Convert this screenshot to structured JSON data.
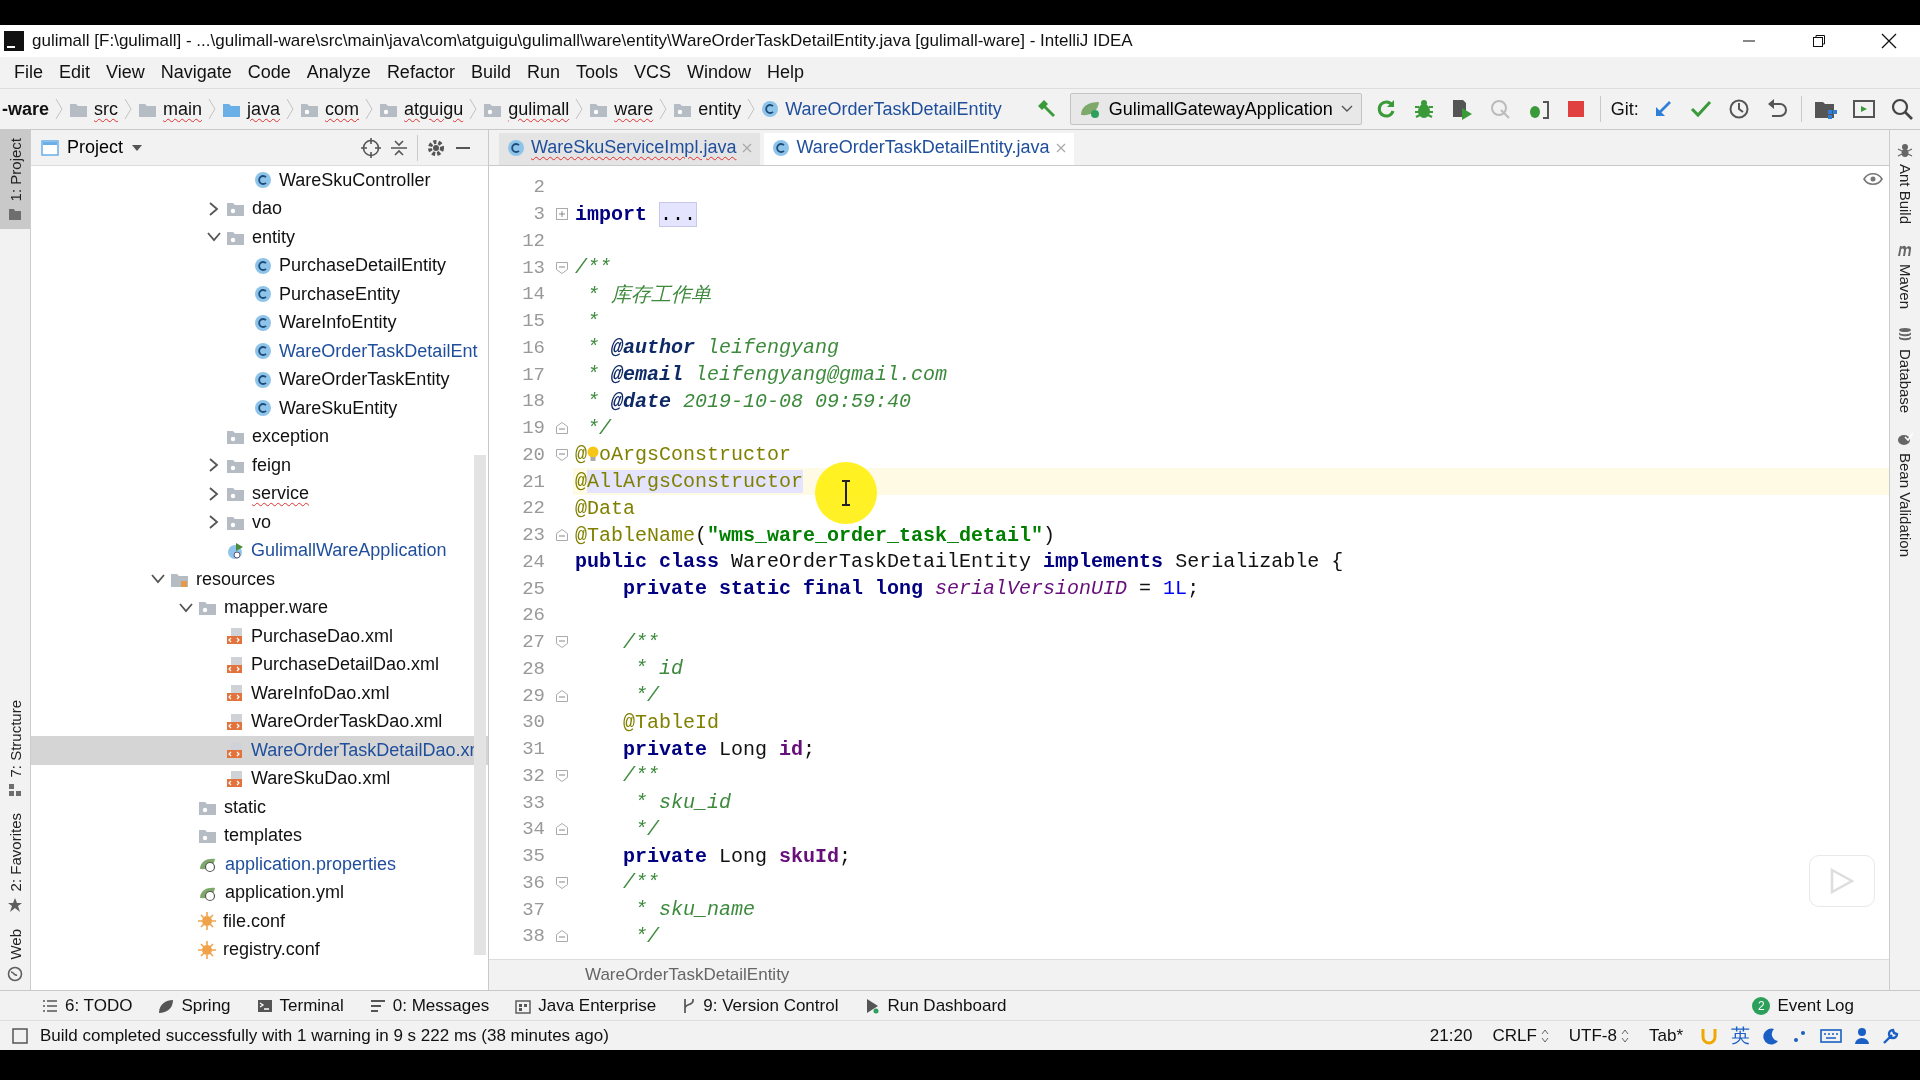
{
  "window": {
    "title": "gulimall [F:\\gulimall] - ...\\gulimall-ware\\src\\main\\java\\com\\atguigu\\gulimall\\ware\\entity\\WareOrderTaskDetailEntity.java [gulimall-ware] - IntelliJ IDEA"
  },
  "menu": [
    "File",
    "Edit",
    "View",
    "Navigate",
    "Code",
    "Analyze",
    "Refactor",
    "Build",
    "Run",
    "Tools",
    "VCS",
    "Window",
    "Help"
  ],
  "breadcrumbs": [
    {
      "label": "-ware",
      "kind": "module",
      "error": false
    },
    {
      "label": "src",
      "kind": "folder",
      "error": true
    },
    {
      "label": "main",
      "kind": "folder",
      "error": true
    },
    {
      "label": "java",
      "kind": "source-folder",
      "error": true
    },
    {
      "label": "com",
      "kind": "package",
      "error": true
    },
    {
      "label": "atguigu",
      "kind": "package",
      "error": true
    },
    {
      "label": "gulimall",
      "kind": "package",
      "error": true
    },
    {
      "label": "ware",
      "kind": "package",
      "error": true
    },
    {
      "label": "entity",
      "kind": "package",
      "error": false
    },
    {
      "label": "WareOrderTaskDetailEntity",
      "kind": "class",
      "error": false
    }
  ],
  "run_config": {
    "label": "GulimallGatewayApplication"
  },
  "vcs_label": "Git:",
  "left_stripe": [
    {
      "label": "1: Project",
      "kind": "folder",
      "selected": true
    },
    {
      "label": "7: Structure",
      "kind": "structure",
      "selected": false
    },
    {
      "label": "2: Favorites",
      "kind": "star",
      "selected": false
    },
    {
      "label": "Web",
      "kind": "globe",
      "selected": false
    }
  ],
  "project_panel": {
    "title": "Project",
    "tree": [
      {
        "kind": "offscreen",
        "children": [
          {
            "kind": "offscreen",
            "children": [
              {
                "kind": "offscreen",
                "children": [
                  {
                    "label": "WareSkuController",
                    "kind": "class",
                    "selected": false,
                    "modified": false,
                    "error": false
                  }
                ]
              },
              {
                "label": "dao",
                "kind": "package",
                "expanded": false,
                "selected": false,
                "modified": false,
                "error": false
              },
              {
                "label": "entity",
                "kind": "package",
                "expanded": true,
                "selected": false,
                "modified": false,
                "error": false,
                "children": [
                  {
                    "label": "PurchaseDetailEntity",
                    "kind": "class",
                    "selected": false,
                    "modified": false,
                    "error": false
                  },
                  {
                    "label": "PurchaseEntity",
                    "kind": "class",
                    "selected": false,
                    "modified": false,
                    "error": false
                  },
                  {
                    "label": "WareInfoEntity",
                    "kind": "class",
                    "selected": false,
                    "modified": false,
                    "error": false
                  },
                  {
                    "label": "WareOrderTaskDetailEnt",
                    "kind": "class",
                    "selected": false,
                    "modified": true,
                    "error": false
                  },
                  {
                    "label": "WareOrderTaskEntity",
                    "kind": "class",
                    "selected": false,
                    "modified": false,
                    "error": false
                  },
                  {
                    "label": "WareSkuEntity",
                    "kind": "class",
                    "selected": false,
                    "modified": false,
                    "error": false
                  }
                ]
              },
              {
                "label": "exception",
                "kind": "package",
                "selected": false,
                "modified": false,
                "error": false
              },
              {
                "label": "feign",
                "kind": "package",
                "expanded": false,
                "selected": false,
                "modified": false,
                "error": false
              },
              {
                "label": "service",
                "kind": "package",
                "expanded": false,
                "selected": false,
                "modified": false,
                "error": true
              },
              {
                "label": "vo",
                "kind": "package",
                "expanded": false,
                "selected": false,
                "modified": false,
                "error": false
              },
              {
                "label": "GulimallWareApplication",
                "kind": "app",
                "selected": false,
                "modified": true,
                "error": false
              }
            ]
          }
        ]
      },
      {
        "label": "resources",
        "kind": "resources",
        "expanded": true,
        "selected": false,
        "modified": false,
        "error": false,
        "children": [
          {
            "label": "mapper.ware",
            "kind": "package",
            "expanded": true,
            "selected": false,
            "modified": false,
            "error": false,
            "children": [
              {
                "label": "PurchaseDao.xml",
                "kind": "xml",
                "selected": false,
                "modified": false,
                "error": false
              },
              {
                "label": "PurchaseDetailDao.xml",
                "kind": "xml",
                "selected": false,
                "modified": false,
                "error": false
              },
              {
                "label": "WareInfoDao.xml",
                "kind": "xml",
                "selected": false,
                "modified": false,
                "error": false
              },
              {
                "label": "WareOrderTaskDao.xml",
                "kind": "xml",
                "selected": false,
                "modified": false,
                "error": false
              },
              {
                "label": "WareOrderTaskDetailDao.xr",
                "kind": "xml",
                "selected": true,
                "modified": true,
                "error": false
              },
              {
                "label": "WareSkuDao.xml",
                "kind": "xml",
                "selected": false,
                "modified": false,
                "error": false
              }
            ]
          },
          {
            "label": "static",
            "kind": "package",
            "selected": false,
            "modified": false,
            "error": false
          },
          {
            "label": "templates",
            "kind": "package",
            "selected": false,
            "modified": false,
            "error": false
          },
          {
            "label": "application.properties",
            "kind": "spring-config",
            "selected": false,
            "modified": true,
            "error": false
          },
          {
            "label": "application.yml",
            "kind": "spring-config",
            "selected": false,
            "modified": false,
            "error": false
          },
          {
            "label": "file.conf",
            "kind": "conf",
            "selected": false,
            "modified": false,
            "error": false
          },
          {
            "label": "registry.conf",
            "kind": "conf",
            "selected": false,
            "modified": false,
            "error": false
          }
        ]
      }
    ]
  },
  "editor": {
    "tabs": [
      {
        "label": "WareSkuServiceImpl.java",
        "selected": false,
        "error": true
      },
      {
        "label": "WareOrderTaskDetailEntity.java",
        "selected": true,
        "error": false
      }
    ],
    "lines": [
      {
        "number": "2",
        "kind": "plain",
        "current": false
      },
      {
        "number": "3",
        "kind": "fold-collapsed",
        "current": false,
        "tokens": [
          {
            "kind": "keyword",
            "text": "import "
          },
          {
            "kind": "folded",
            "text": "..."
          }
        ]
      },
      {
        "number": "12",
        "kind": "plain",
        "current": false
      },
      {
        "number": "13",
        "kind": "fold-start",
        "current": false,
        "tokens": [
          {
            "kind": "doc",
            "text": "/**"
          }
        ]
      },
      {
        "number": "14",
        "kind": "plain",
        "current": false,
        "tokens": [
          {
            "kind": "doc",
            "text": " * 库存工作单"
          }
        ]
      },
      {
        "number": "15",
        "kind": "plain",
        "current": false,
        "tokens": [
          {
            "kind": "doc",
            "text": " *"
          }
        ]
      },
      {
        "number": "16",
        "kind": "plain",
        "current": false,
        "tokens": [
          {
            "kind": "doc",
            "text": " * "
          },
          {
            "kind": "doctag",
            "text": "@author"
          },
          {
            "kind": "doc",
            "text": " leifengyang"
          }
        ]
      },
      {
        "number": "17",
        "kind": "plain",
        "current": false,
        "tokens": [
          {
            "kind": "doc",
            "text": " * "
          },
          {
            "kind": "doctag",
            "text": "@email"
          },
          {
            "kind": "doc",
            "text": " leifengyang@gmail.com"
          }
        ]
      },
      {
        "number": "18",
        "kind": "plain",
        "current": false,
        "tokens": [
          {
            "kind": "doc",
            "text": " * "
          },
          {
            "kind": "doctag",
            "text": "@date"
          },
          {
            "kind": "doc",
            "text": " 2019-10-08 09:59:40"
          }
        ]
      },
      {
        "number": "19",
        "kind": "fold-end",
        "current": false,
        "tokens": [
          {
            "kind": "doc",
            "text": " */"
          }
        ]
      },
      {
        "number": "20",
        "kind": "fold-start",
        "current": false,
        "tokens": [
          {
            "kind": "annotation",
            "text": "@"
          },
          {
            "kind": "bulb"
          },
          {
            "kind": "annotation",
            "text": "oArgsConstructor"
          }
        ]
      },
      {
        "number": "21",
        "kind": "plain",
        "current": true,
        "tokens": [
          {
            "kind": "annotation",
            "text": "@"
          },
          {
            "kind": "annotation-usage",
            "text": "AllArgsConstructor"
          }
        ]
      },
      {
        "number": "22",
        "kind": "plain",
        "current": false,
        "tokens": [
          {
            "kind": "annotation",
            "text": "@Data"
          }
        ]
      },
      {
        "number": "23",
        "kind": "fold-end",
        "current": false,
        "tokens": [
          {
            "kind": "annotation",
            "text": "@TableName"
          },
          {
            "kind": "plain",
            "text": "("
          },
          {
            "kind": "string",
            "text": "\"wms_ware_order_task_detail\""
          },
          {
            "kind": "plain",
            "text": ")"
          }
        ]
      },
      {
        "number": "24",
        "kind": "plain",
        "current": false,
        "tokens": [
          {
            "kind": "keyword",
            "text": "public class"
          },
          {
            "kind": "plain",
            "text": " WareOrderTaskDetailEntity "
          },
          {
            "kind": "keyword",
            "text": "implements"
          },
          {
            "kind": "plain",
            "text": " Serializable {"
          }
        ]
      },
      {
        "number": "25",
        "kind": "plain",
        "current": false,
        "tokens": [
          {
            "kind": "keyword",
            "text": "    private static final long "
          },
          {
            "kind": "static-field",
            "text": "serialVersionUID"
          },
          {
            "kind": "plain",
            "text": " = "
          },
          {
            "kind": "number",
            "text": "1L"
          },
          {
            "kind": "plain",
            "text": ";"
          }
        ]
      },
      {
        "number": "26",
        "kind": "plain",
        "current": false
      },
      {
        "number": "27",
        "kind": "fold-start",
        "current": false,
        "tokens": [
          {
            "kind": "doc",
            "text": "    /**"
          }
        ]
      },
      {
        "number": "28",
        "kind": "plain",
        "current": false,
        "tokens": [
          {
            "kind": "doc",
            "text": "     * id"
          }
        ]
      },
      {
        "number": "29",
        "kind": "fold-end",
        "current": false,
        "tokens": [
          {
            "kind": "doc",
            "text": "     */"
          }
        ]
      },
      {
        "number": "30",
        "kind": "plain",
        "current": false,
        "tokens": [
          {
            "kind": "annotation",
            "text": "    @TableId"
          }
        ]
      },
      {
        "number": "31",
        "kind": "plain",
        "current": false,
        "tokens": [
          {
            "kind": "keyword",
            "text": "    private"
          },
          {
            "kind": "plain",
            "text": " Long "
          },
          {
            "kind": "field",
            "text": "id"
          },
          {
            "kind": "plain",
            "text": ";"
          }
        ]
      },
      {
        "number": "32",
        "kind": "fold-start",
        "current": false,
        "tokens": [
          {
            "kind": "doc",
            "text": "    /**"
          }
        ]
      },
      {
        "number": "33",
        "kind": "plain",
        "current": false,
        "tokens": [
          {
            "kind": "doc",
            "text": "     * sku_id"
          }
        ]
      },
      {
        "number": "34",
        "kind": "fold-end",
        "current": false,
        "tokens": [
          {
            "kind": "doc",
            "text": "     */"
          }
        ]
      },
      {
        "number": "35",
        "kind": "plain",
        "current": false,
        "tokens": [
          {
            "kind": "keyword",
            "text": "    private"
          },
          {
            "kind": "plain",
            "text": " Long "
          },
          {
            "kind": "field",
            "text": "skuId"
          },
          {
            "kind": "plain",
            "text": ";"
          }
        ]
      },
      {
        "number": "36",
        "kind": "fold-start",
        "current": false,
        "tokens": [
          {
            "kind": "doc",
            "text": "    /**"
          }
        ]
      },
      {
        "number": "37",
        "kind": "plain",
        "current": false,
        "tokens": [
          {
            "kind": "doc",
            "text": "     * sku_name"
          }
        ]
      },
      {
        "number": "38",
        "kind": "fold-end",
        "current": false,
        "tokens": [
          {
            "kind": "doc",
            "text": "     */"
          }
        ]
      }
    ],
    "breadcrumb": "WareOrderTaskDetailEntity"
  },
  "right_stripe": [
    {
      "label": "Ant Build",
      "kind": "ant"
    },
    {
      "label": "Maven",
      "kind": "maven"
    },
    {
      "label": "Database",
      "kind": "database"
    },
    {
      "label": "Bean Validation",
      "kind": "bean"
    }
  ],
  "tool_windows": [
    {
      "label": "6: TODO",
      "kind": "todo"
    },
    {
      "label": "Spring",
      "kind": "spring"
    },
    {
      "label": "Terminal",
      "kind": "terminal"
    },
    {
      "label": "0: Messages",
      "kind": "messages"
    },
    {
      "label": "Java Enterprise",
      "kind": "enterprise"
    },
    {
      "label": "9: Version Control",
      "kind": "vcs"
    },
    {
      "label": "Run Dashboard",
      "kind": "run"
    },
    {
      "label": "Event Log",
      "kind": "event-log",
      "badge": "2"
    }
  ],
  "status_bar": {
    "message": "Build completed successfully with 1 warning in 9 s 222 ms (38 minutes ago)",
    "position": "21:20",
    "line_separator": "CRLF",
    "encoding": "UTF-8",
    "indent": "Tab*",
    "ime": "英"
  }
}
